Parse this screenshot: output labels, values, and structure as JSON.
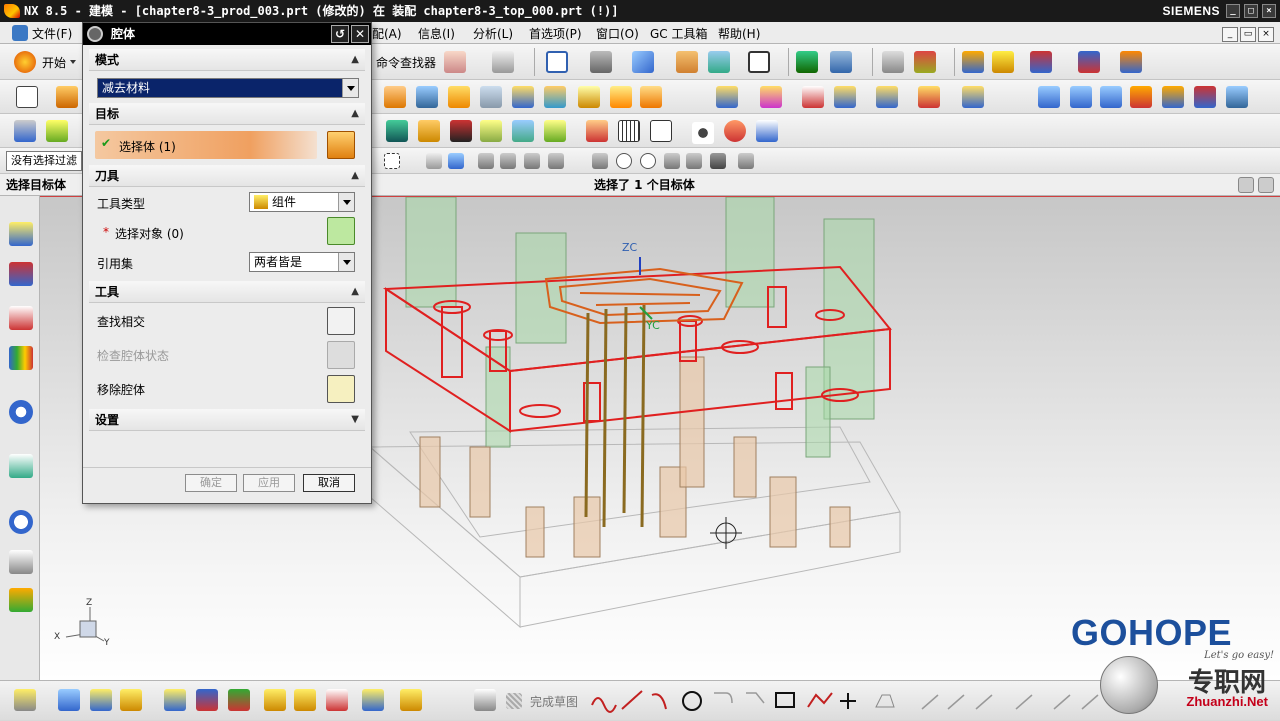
{
  "titlebar": {
    "title": "NX 8.5 - 建模 - [chapter8-3_prod_003.prt (修改的) 在 装配 chapter8-3_top_000.prt (!)]",
    "brand": "SIEMENS"
  },
  "menubar": {
    "items": [
      "文件(F)",
      "配(A)",
      "信息(I)",
      "分析(L)",
      "首选项(P)",
      "窗口(O)",
      "GC 工具箱",
      "帮助(H)"
    ]
  },
  "toolbar": {
    "start_label": "开始",
    "command_finder": "命令查找器",
    "filter_placeholder": "没有选择过滤",
    "sketch_finish": "完成草图"
  },
  "cue_line": {
    "left": "选择目标体",
    "center": "选择了 1 个目标体"
  },
  "dialog": {
    "title": "腔体",
    "sections": {
      "mode": "模式",
      "target": "目标",
      "tool": "刀具",
      "tools": "工具",
      "settings": "设置"
    },
    "mode_value": "减去材料",
    "target_row": "选择体 (1)",
    "tool_type_label": "工具类型",
    "tool_type_value": "组件",
    "select_object_label": "选择对象 (0)",
    "reference_set_label": "引用集",
    "reference_set_value": "两者皆是",
    "find_intersect": "查找相交",
    "check_cavity": "检查腔体状态",
    "remove_cavity": "移除腔体",
    "ok": "确定",
    "apply": "应用",
    "cancel": "取消"
  },
  "viewport": {
    "axis_zc": "ZC",
    "axis_yc": "YC",
    "triad_z": "Z",
    "triad_x": "X",
    "triad_y": "Y"
  },
  "watermark": {
    "brand": "GOHOPE",
    "slogan": "Let's go easy!",
    "cn": "专职网",
    "url": "Zhuanzhi.Net"
  },
  "colors": {
    "dialog_title": "#000000",
    "target_highlight": "#f0a060",
    "mold_outline": "#e02020",
    "part_orange": "#d8601c",
    "brand_blue": "#1c4f9c"
  }
}
